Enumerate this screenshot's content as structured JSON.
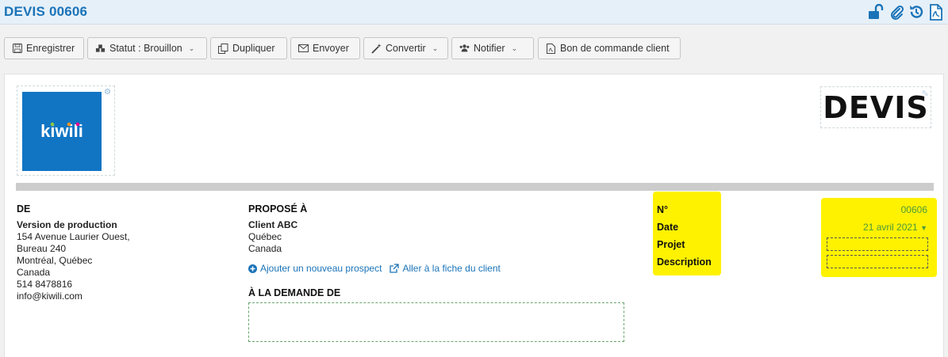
{
  "header": {
    "title": "DEVIS 00606"
  },
  "title_icons": [
    "unlock-icon",
    "paperclip-icon",
    "history-icon",
    "pdf-icon"
  ],
  "toolbar": {
    "save": "Enregistrer",
    "status": "Statut : Brouillon",
    "duplicate": "Dupliquer",
    "send": "Envoyer",
    "convert": "Convertir",
    "notify": "Notifier",
    "purchase_order": "Bon de commande client"
  },
  "document": {
    "logo_text": "kiwili",
    "heading": "DEVIS",
    "from": {
      "label": "DE",
      "company": "Version de production",
      "lines": [
        "154 Avenue Laurier Ouest,",
        "Bureau 240",
        "Montréal, Québec",
        "Canada",
        "514 8478816",
        "info@kiwili.com"
      ]
    },
    "to": {
      "label": "PROPOSÉ À",
      "client": "Client ABC",
      "lines": [
        "Québec",
        "Canada"
      ],
      "add_prospect": "Ajouter un nouveau prospect",
      "client_sheet": "Aller à la fiche du client"
    },
    "requested_by": {
      "label": "À LA DEMANDE DE",
      "value": ""
    },
    "meta": {
      "number_label": "N°",
      "number": "00606",
      "date_label": "Date",
      "date": "21 avril 2021",
      "project_label": "Projet",
      "project": "",
      "description_label": "Description",
      "description": ""
    }
  },
  "colors": {
    "accent": "#1a73b8",
    "logo_bg": "#1175c4",
    "highlight": "#fff200",
    "value_green": "#4d9a3c"
  }
}
